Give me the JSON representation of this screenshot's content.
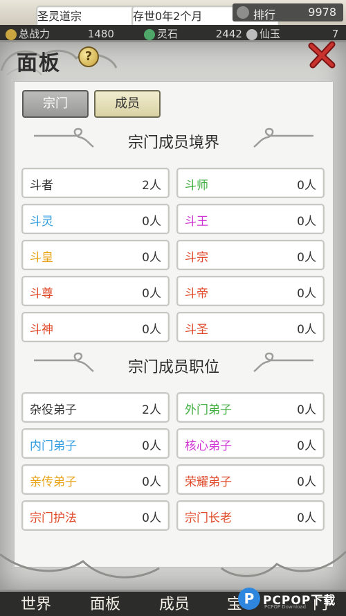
{
  "hud": {
    "sect_name": "圣灵道宗",
    "era": "存世0年2个月",
    "rank_label": "排行",
    "rank_value": "9978",
    "res1_label": "总战力",
    "res1_value": "1480",
    "res2_label": "灵石",
    "res2_value": "2442",
    "res3_label": "仙玉",
    "res3_value": "7"
  },
  "panel": {
    "title": "面板",
    "help": "?",
    "tabs": [
      {
        "label": "宗门",
        "active": false
      },
      {
        "label": "成员",
        "active": true
      }
    ]
  },
  "realm_section": {
    "title": "宗门成员境界",
    "items": [
      {
        "name": "斗者",
        "count": "2人",
        "color": "#333333"
      },
      {
        "name": "斗师",
        "count": "0人",
        "color": "#3fae3f"
      },
      {
        "name": "斗灵",
        "count": "0人",
        "color": "#2f9de0"
      },
      {
        "name": "斗王",
        "count": "0人",
        "color": "#d033d3"
      },
      {
        "name": "斗皇",
        "count": "0人",
        "color": "#e8a317"
      },
      {
        "name": "斗宗",
        "count": "0人",
        "color": "#e04a2a"
      },
      {
        "name": "斗尊",
        "count": "0人",
        "color": "#e04a2a"
      },
      {
        "name": "斗帝",
        "count": "0人",
        "color": "#e04a2a"
      },
      {
        "name": "斗神",
        "count": "0人",
        "color": "#e04a2a"
      },
      {
        "name": "斗圣",
        "count": "0人",
        "color": "#e04a2a"
      }
    ]
  },
  "position_section": {
    "title": "宗门成员职位",
    "items": [
      {
        "name": "杂役弟子",
        "count": "2人",
        "color": "#333333"
      },
      {
        "name": "外门弟子",
        "count": "0人",
        "color": "#3fae3f"
      },
      {
        "name": "内门弟子",
        "count": "0人",
        "color": "#2f9de0"
      },
      {
        "name": "核心弟子",
        "count": "0人",
        "color": "#d033d3"
      },
      {
        "name": "亲传弟子",
        "count": "0人",
        "color": "#e8a317"
      },
      {
        "name": "荣耀弟子",
        "count": "0人",
        "color": "#e04a2a"
      },
      {
        "name": "宗门护法",
        "count": "0人",
        "color": "#e04a2a"
      },
      {
        "name": "宗门长老",
        "count": "0人",
        "color": "#e04a2a"
      }
    ]
  },
  "bottom_nav": [
    "世界",
    "面板",
    "成员",
    "宝",
    "门"
  ],
  "watermark": {
    "text": "PCPOP下载",
    "sub": "PCPOP Download"
  }
}
